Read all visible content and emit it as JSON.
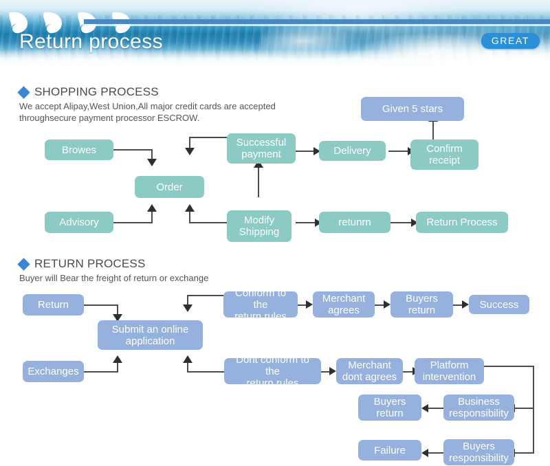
{
  "banner": {
    "title": "Return process",
    "badge": "GREAT",
    "wave_icon": "wave-curl-icon"
  },
  "shopping_section": {
    "heading": "SHOPPING PROCESS",
    "bullet_icon": "diamond-bullet-icon",
    "description": "We accept Alipay,West Union,All major credit cards are accepted\nthroughsecure payment processor ESCROW.",
    "nodes": {
      "browes": "Browes",
      "order": "Order",
      "advisory": "Advisory",
      "successful_payment": "Successful\npayment",
      "modify_shipping": "Modify\nShipping",
      "delivery": "Delivery",
      "confirm_receipt": "Confirm\nreceipt",
      "given_5_stars": "Given 5 stars",
      "retunrn": "retunrn",
      "return_process": "Return Process"
    }
  },
  "return_section": {
    "heading": "RETURN PROCESS",
    "bullet_icon": "diamond-bullet-icon",
    "description": "Buyer will Bear the freight of return or exchange",
    "nodes": {
      "return": "Return",
      "exchanges": "Exchanges",
      "submit_online_application": "Submit an online\napplication",
      "conform_rules": "Conform to the\nreturn rules",
      "merchant_agrees": "Merchant\nagrees",
      "buyers_return_top": "Buyers\nreturn",
      "success": "Success",
      "dont_conform_rules": "Dont conform to the\nreturn rules",
      "merchant_dont_agrees": "Merchant\ndont agrees",
      "platform_intervention": "Platform\nintervention",
      "business_responsibility": "Business\nresponsibility",
      "buyers_return_mid": "Buyers\nreturn",
      "buyers_responsibility": "Buyers\nresponsibility",
      "failure": "Failure"
    }
  },
  "colors": {
    "teal": "#8ccbc3",
    "periwinkle": "#96b1de",
    "accent_blue": "#3a86d4",
    "badge_blue": "#2a8fd6",
    "connector": "#4b4b4b"
  }
}
